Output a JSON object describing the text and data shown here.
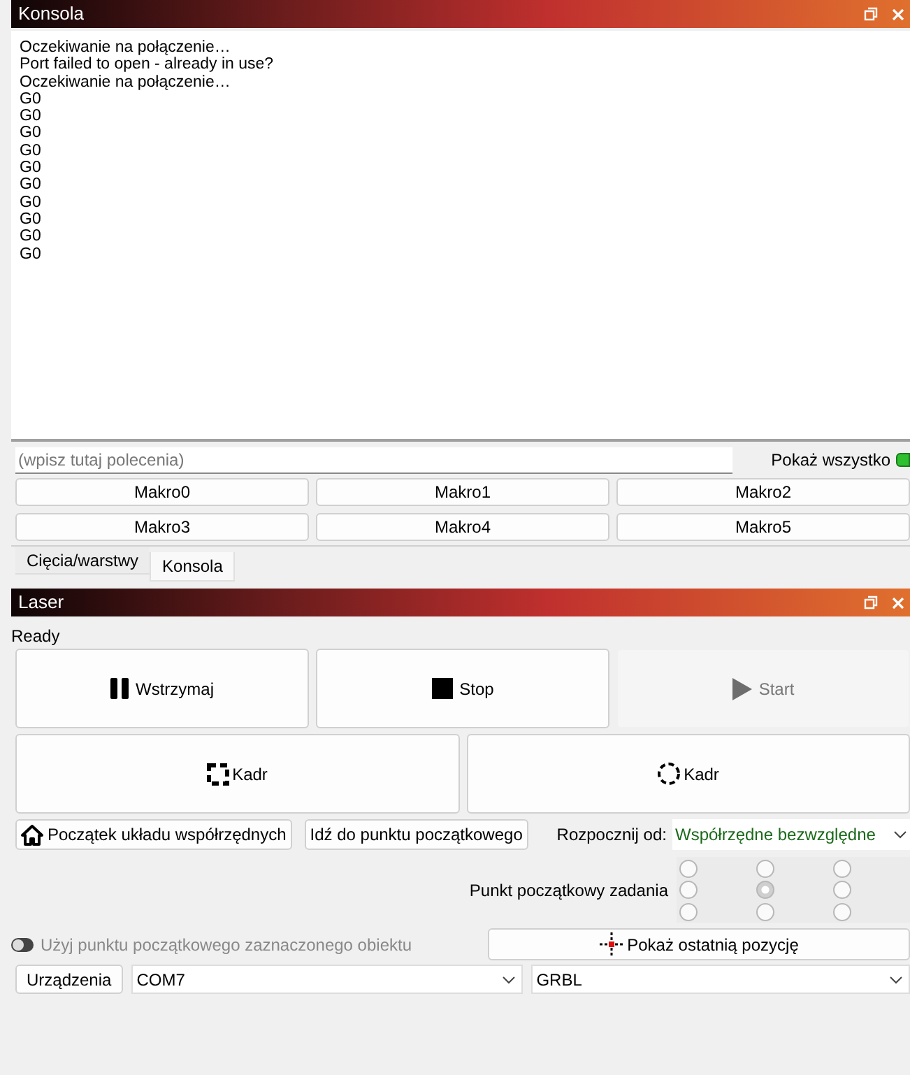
{
  "console": {
    "title": "Konsola",
    "lines": [
      "Oczekiwanie na połączenie…",
      "Port failed to open - already in use?",
      "Oczekiwanie na połączenie…",
      "G0",
      "G0",
      "G0",
      "G0",
      "G0",
      "G0",
      "G0",
      "G0",
      "G0",
      "G0"
    ],
    "command_placeholder": "(wpisz tutaj polecenia)",
    "show_all": {
      "label": "Pokaż wszystko",
      "on": true
    },
    "macros": [
      "Makro0",
      "Makro1",
      "Makro2",
      "Makro3",
      "Makro4",
      "Makro5"
    ],
    "tabs": [
      {
        "label": "Cięcia/warstwy",
        "selected": false
      },
      {
        "label": "Konsola",
        "selected": true
      }
    ]
  },
  "laser": {
    "title": "Laser",
    "status": "Ready",
    "buttons": [
      {
        "label": "Wstrzymaj",
        "kind": "pause",
        "disabled": false
      },
      {
        "label": "Stop",
        "kind": "stop",
        "disabled": false
      },
      {
        "label": "Start",
        "kind": "play",
        "disabled": true
      }
    ],
    "frame_buttons": [
      {
        "label": "Kadr",
        "kind": "square"
      },
      {
        "label": "Kadr",
        "kind": "circle"
      }
    ],
    "origin_button": "Początek układu współrzędnych",
    "go_home_button": "Idź do punktu początkowego",
    "start_from": {
      "label": "Rozpocznij od:",
      "value": "Współrzędne bezwzględne"
    },
    "job_origin": {
      "label": "Punkt początkowy zadania",
      "disabled": true,
      "points": [
        {
          "selected": false
        },
        {
          "selected": false
        },
        {
          "selected": false
        },
        {
          "selected": false
        },
        {
          "selected": true
        },
        {
          "selected": false
        },
        {
          "selected": false
        },
        {
          "selected": false
        },
        {
          "selected": false
        }
      ]
    },
    "use_selection_origin": {
      "label": "Użyj punktu początkowego zaznaczonego obiektu",
      "on": false,
      "disabled": true
    },
    "show_last_position": "Pokaż ostatnią pozycję",
    "devices_button": "Urządzenia",
    "port": "COM7",
    "device_type": "GRBL"
  }
}
